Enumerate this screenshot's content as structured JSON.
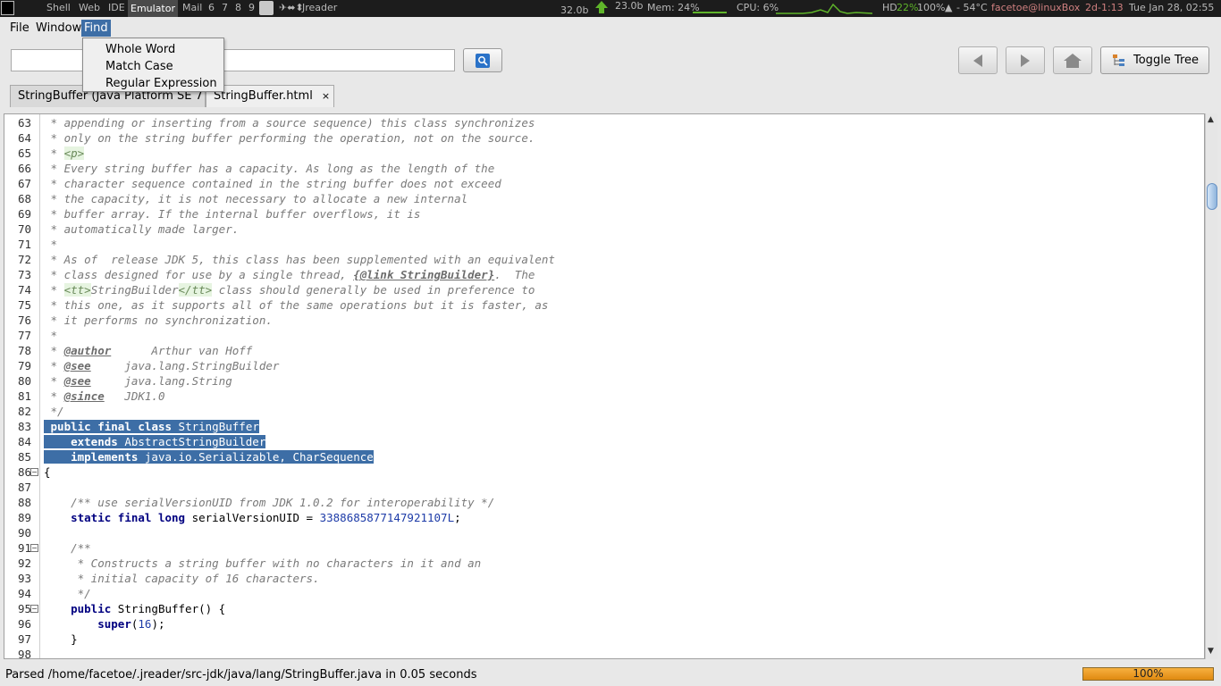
{
  "sysbar": {
    "workspaces": [
      "Shell",
      "Web",
      "IDE",
      "Emulator",
      "Mail",
      "6",
      "7",
      "8",
      "9"
    ],
    "active_workspace": "Emulator",
    "window_title": "Jreader",
    "net_down": "32.0b",
    "net_up": "23.0b",
    "mem": "Mem: 24%",
    "cpu": "CPU: 6%",
    "hd_label": "HD",
    "hd_value": "22%",
    "battery": "100%",
    "temp": "- 54°C",
    "user": "facetoe@linuxBox",
    "uptime": "2d-1:13",
    "clock": "Tue Jan 28, 02:55",
    "accent_color": "#5fb52a"
  },
  "menubar": {
    "items": [
      "File",
      "Window",
      "Find"
    ],
    "active": "Find"
  },
  "find_menu": {
    "items": [
      "Whole Word",
      "Match Case",
      "Regular Expression"
    ]
  },
  "toolbar": {
    "search_value": "",
    "search_icon": "search-icon",
    "back_icon": "back-arrow-icon",
    "forward_icon": "forward-arrow-icon",
    "home_icon": "home-icon",
    "toggle_tree_label": "Toggle Tree"
  },
  "tabs": [
    {
      "label": "StringBuffer (Java Platform SE 7 )",
      "active": false
    },
    {
      "label": "StringBuffer.html",
      "active": true,
      "close": "×"
    }
  ],
  "editor": {
    "lines": [
      {
        "n": "63",
        "text": " * appending or inserting from a source sequence) this class synchronizes"
      },
      {
        "n": "64",
        "text": " * only on the string buffer performing the operation, not on the source."
      },
      {
        "n": "65",
        "text": " * <p>"
      },
      {
        "n": "66",
        "text": " * Every string buffer has a capacity. As long as the length of the"
      },
      {
        "n": "67",
        "text": " * character sequence contained in the string buffer does not exceed"
      },
      {
        "n": "68",
        "text": " * the capacity, it is not necessary to allocate a new internal"
      },
      {
        "n": "69",
        "text": " * buffer array. If the internal buffer overflows, it is"
      },
      {
        "n": "70",
        "text": " * automatically made larger."
      },
      {
        "n": "71",
        "text": " *"
      },
      {
        "n": "72",
        "text": " * As of  release JDK 5, this class has been supplemented with an equivalent"
      },
      {
        "n": "73",
        "text": " * class designed for use by a single thread, {@link StringBuilder}.  The"
      },
      {
        "n": "74",
        "text": " * <tt>StringBuilder</tt> class should generally be used in preference to"
      },
      {
        "n": "75",
        "text": " * this one, as it supports all of the same operations but it is faster, as"
      },
      {
        "n": "76",
        "text": " * it performs no synchronization."
      },
      {
        "n": "77",
        "text": " *"
      },
      {
        "n": "78",
        "text": " * @author      Arthur van Hoff"
      },
      {
        "n": "79",
        "text": " * @see     java.lang.StringBuilder"
      },
      {
        "n": "80",
        "text": " * @see     java.lang.String"
      },
      {
        "n": "81",
        "text": " * @since   JDK1.0"
      },
      {
        "n": "82",
        "text": " */"
      },
      {
        "n": "83",
        "text": " public final class StringBuffer"
      },
      {
        "n": "84",
        "text": "    extends AbstractStringBuilder"
      },
      {
        "n": "85",
        "text": "    implements java.io.Serializable, CharSequence"
      },
      {
        "n": "86",
        "text": "{"
      },
      {
        "n": "87",
        "text": ""
      },
      {
        "n": "88",
        "text": "    /** use serialVersionUID from JDK 1.0.2 for interoperability */"
      },
      {
        "n": "89",
        "text": "    static final long serialVersionUID = 3388685877147921107L;"
      },
      {
        "n": "90",
        "text": ""
      },
      {
        "n": "91",
        "text": "    /**"
      },
      {
        "n": "92",
        "text": "     * Constructs a string buffer with no characters in it and an"
      },
      {
        "n": "93",
        "text": "     * initial capacity of 16 characters."
      },
      {
        "n": "94",
        "text": "     */"
      },
      {
        "n": "95",
        "text": "    public StringBuffer() {"
      },
      {
        "n": "96",
        "text": "        super(16);"
      },
      {
        "n": "97",
        "text": "    }"
      },
      {
        "n": "98",
        "text": ""
      }
    ]
  },
  "status": {
    "text": "Parsed /home/facetoe/.jreader/src-jdk/java/lang/StringBuffer.java in 0.05 seconds",
    "progress_label": "100%",
    "progress_fraction": 1.0
  }
}
